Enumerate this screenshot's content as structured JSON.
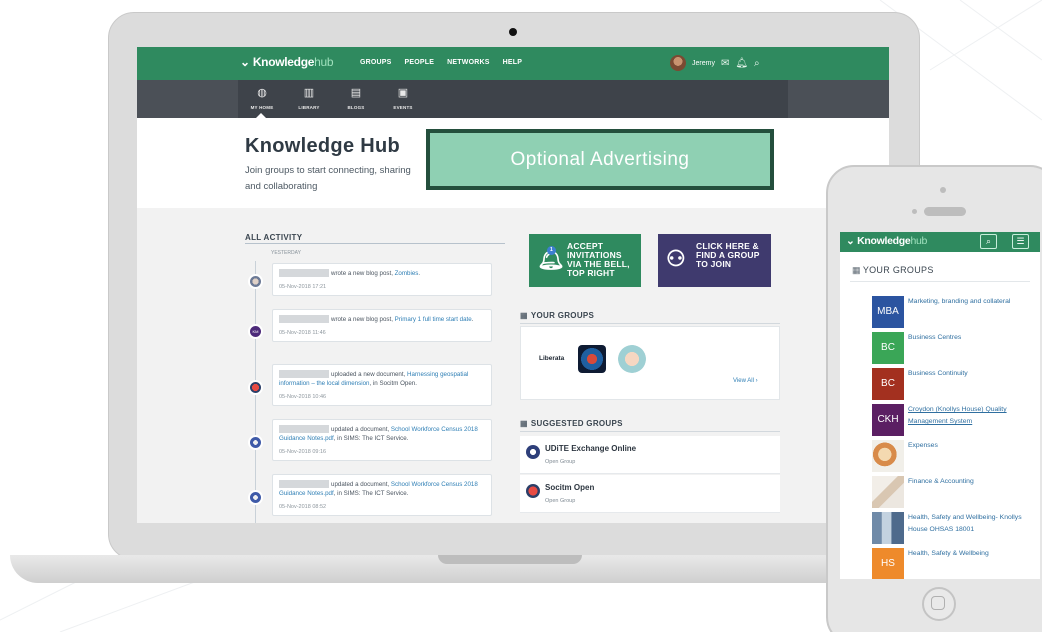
{
  "laptop": {
    "app": {
      "logo_main": "Knowledge",
      "logo_hub": "hub",
      "nav": [
        "GROUPS",
        "PEOPLE",
        "NETWORKS",
        "HELP"
      ],
      "user_name": "Jeremy",
      "subnav": [
        {
          "label": "MY HOME",
          "icon": "globe-icon"
        },
        {
          "label": "LIBRARY",
          "icon": "library-icon"
        },
        {
          "label": "BLOGS",
          "icon": "blog-icon"
        },
        {
          "label": "EVENTS",
          "icon": "calendar-icon"
        }
      ]
    },
    "hero": {
      "title": "Knowledge Hub",
      "subtitle": "Join groups to start connecting, sharing and collaborating",
      "advert": "Optional Advertising"
    },
    "activity": {
      "heading": "ALL ACTIVITY",
      "day": "YESTERDAY",
      "items": [
        {
          "action": "wrote a new blog post,",
          "link": "Zombies",
          "tail": ".",
          "date": "05-Nov-2018 17:21"
        },
        {
          "action": "wrote a new blog post,",
          "link": "Primary 1 full time start date",
          "tail": ".",
          "date": "05-Nov-2018 11:46",
          "avatar_text": "KM"
        },
        {
          "action": "uploaded a new document,",
          "link": "Harnessing geospatial information – the local dimension",
          "tail": ", in Socitm Open.",
          "date": "05-Nov-2018 10:46"
        },
        {
          "action": "updated a document,",
          "link": "School Workforce Census 2018 Guidance Notes.pdf",
          "tail": ", in SIMS: The ICT Service.",
          "date": "05-Nov-2018 09:16"
        },
        {
          "action": "updated a document,",
          "link": "School Workforce Census 2018 Guidance Notes.pdf",
          "tail": ", in SIMS: The ICT Service.",
          "date": "05-Nov-2018 08:52"
        }
      ]
    },
    "cta": {
      "bell_text": "ACCEPT INVITATIONS VIA THE BELL, TOP RIGHT",
      "bell_badge": "1",
      "find_text": "CLICK HERE & FIND A GROUP TO JOIN"
    },
    "your_groups": {
      "heading": "YOUR GROUPS",
      "first_group": "Liberata",
      "view_all": "View All"
    },
    "suggested_groups": {
      "heading": "SUGGESTED GROUPS",
      "items": [
        {
          "name": "UDiTE Exchange Online",
          "type": "Open Group"
        },
        {
          "name": "Socitm Open",
          "type": "Open Group"
        }
      ]
    }
  },
  "phone": {
    "logo_main": "Knowledge",
    "logo_hub": "hub",
    "heading": "YOUR GROUPS",
    "groups": [
      {
        "badge": "MBA",
        "name": "Marketing, branding and collateral",
        "color": "#2b54a0"
      },
      {
        "badge": "BC",
        "name": "Business Centres",
        "color": "#3aa657"
      },
      {
        "badge": "BC",
        "name": "Business Continuity",
        "color": "#a3301f"
      },
      {
        "badge": "CKH",
        "name": "Croydon (Knollys House) Quality Management System",
        "color": "#5b1f63",
        "underline": true
      },
      {
        "badge": "",
        "name": "Expenses",
        "photo": "food-photo"
      },
      {
        "badge": "",
        "name": "Finance & Accounting",
        "photo": "hand-photo"
      },
      {
        "badge": "",
        "name": "Health, Safety and Wellbeing- Knollys House OHSAS 18001",
        "photo": "building-photo"
      },
      {
        "badge": "HS",
        "name": "Health, Safety & Wellbeing",
        "color": "#ee8a2b"
      }
    ]
  }
}
